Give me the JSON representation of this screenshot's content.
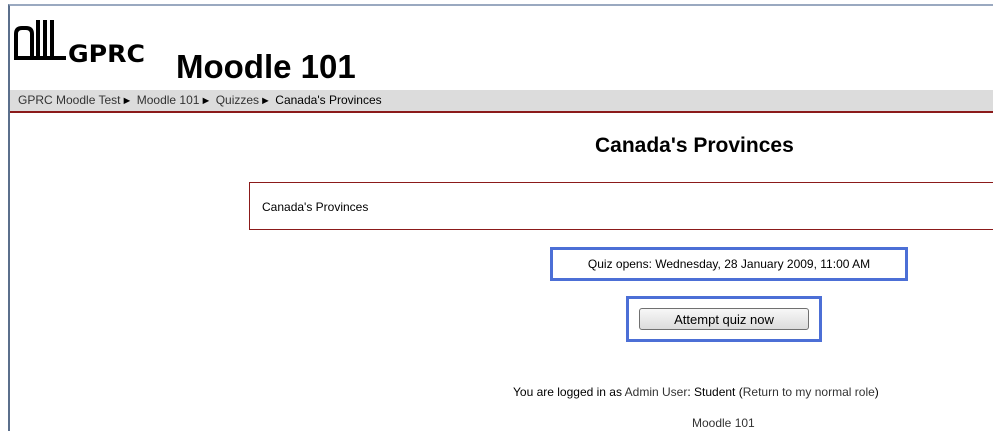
{
  "header": {
    "logo_text": "GPRC",
    "site_title": "Moodle 101"
  },
  "breadcrumb": {
    "items": [
      "GPRC Moodle Test",
      "Moodle 101",
      "Quizzes",
      "Canada's Provinces"
    ],
    "separator": "►"
  },
  "main": {
    "heading": "Canada's Provinces",
    "intro": "Canada's Provinces",
    "quiz_opens": "Quiz opens: Wednesday, 28 January 2009, 11:00 AM",
    "attempt_label": "Attempt quiz now"
  },
  "footer": {
    "logged_prefix": "You are logged in as ",
    "user_name": "Admin User",
    "role_sep": ": ",
    "role": "Student",
    "return_open": " (",
    "return_link": "Return to my normal role",
    "return_close": ")",
    "course": "Moodle 101"
  },
  "colors": {
    "accent_highlight": "#4c6fd6",
    "nav_border": "#8b1a1a"
  }
}
